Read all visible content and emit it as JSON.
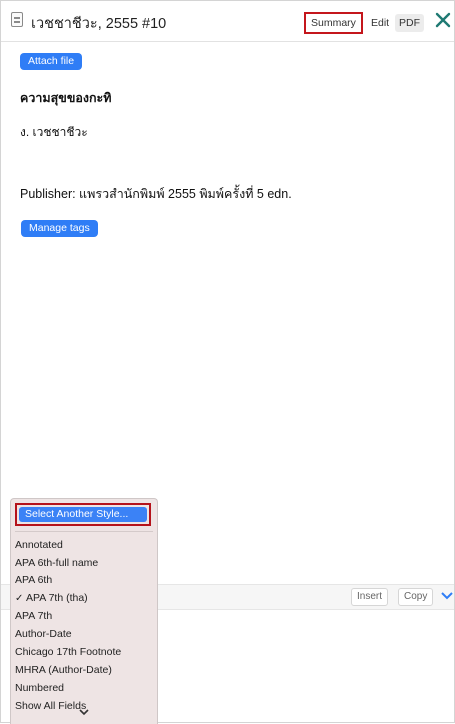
{
  "header": {
    "title": "เวชชาชีวะ, 2555 #10",
    "tabs": {
      "summary": "Summary",
      "edit": "Edit",
      "pdf": "PDF"
    },
    "icons": {
      "document": "document-icon",
      "close": "close-icon"
    },
    "close_color": "#1f7a73"
  },
  "item": {
    "attach_label": "Attach file",
    "title": "ความสุขของกะทิ",
    "author": "ง. เวชชาชีวะ",
    "publisher": "Publisher: แพรวสำนักพิมพ์ 2555 พิมพ์ครั้งที่ 5 edn.",
    "manage_tags_label": "Manage tags"
  },
  "citation_bar": {
    "insert_label": "Insert",
    "copy_label": "Copy"
  },
  "style_menu": {
    "highlighted": "Select Another Style...",
    "items": [
      "Annotated",
      "APA 6th-full name",
      "APA 6th",
      "APA 7th (tha)",
      "APA 7th",
      "Author-Date",
      "Chicago 17th Footnote",
      "MHRA (Author-Date)",
      "Numbered",
      "Show All Fields"
    ],
    "checkmark": "✓",
    "checked_item": "APA 7th (tha)"
  },
  "colors": {
    "accent": "#2f7df6",
    "highlight_outline": "#c4161c"
  }
}
